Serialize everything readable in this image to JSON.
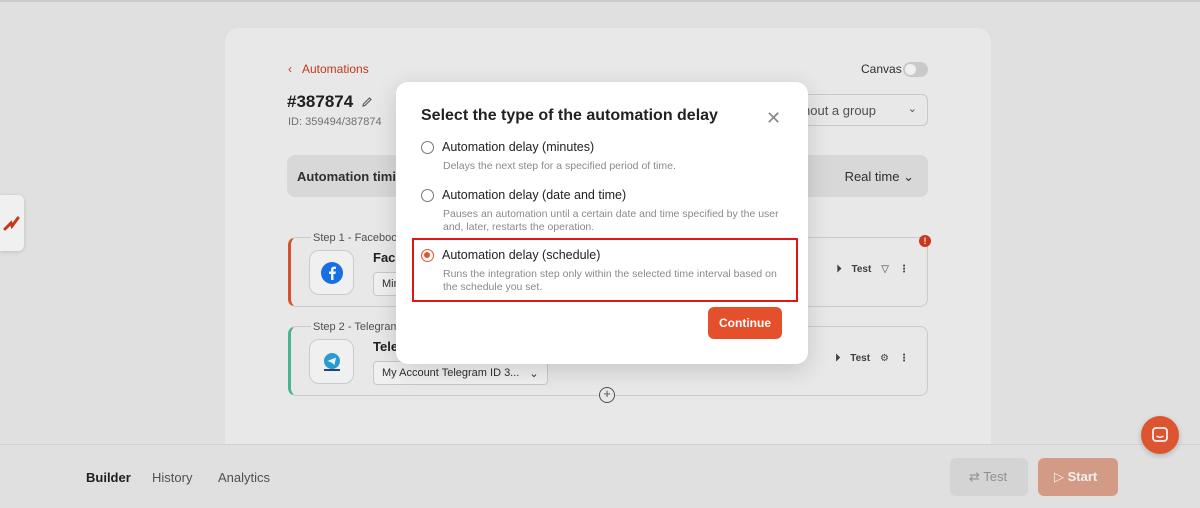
{
  "header": {
    "back_label": "Automations",
    "automation_title": "#387874",
    "automation_id": "ID: 359494/387874",
    "canvas_label": "Canvas",
    "group_select": "hout a group"
  },
  "timing": {
    "label": "Automation timin",
    "value": "Real time"
  },
  "steps": [
    {
      "label": "Step 1 - Faceboo",
      "name": "Face",
      "select": "Min",
      "test_label": "Test"
    },
    {
      "label": "Step 2 - Telegram",
      "name": "Tele",
      "select": "My Account Telegram ID 3...",
      "test_label": "Test"
    }
  ],
  "bottom": {
    "tabs": [
      "Builder",
      "History",
      "Analytics"
    ],
    "test_button": "Test",
    "start_button": "Start"
  },
  "modal": {
    "title": "Select the type of the automation delay",
    "options": [
      {
        "label": "Automation delay (minutes)",
        "description": "Delays the next step for a specified period of time.",
        "checked": false
      },
      {
        "label": "Automation delay (date and time)",
        "description": "Pauses an automation until a certain date and time specified by the user and, later, restarts the operation.",
        "checked": false
      },
      {
        "label": "Automation delay (schedule)",
        "description": "Runs the integration step only within the selected time interval based on the schedule you set.",
        "checked": true
      }
    ],
    "continue_button": "Continue"
  },
  "colors": {
    "accent": "#e5502c",
    "highlight": "#e0161b",
    "step1_border": "#e4572e",
    "step2_border": "#4fbf9a"
  }
}
